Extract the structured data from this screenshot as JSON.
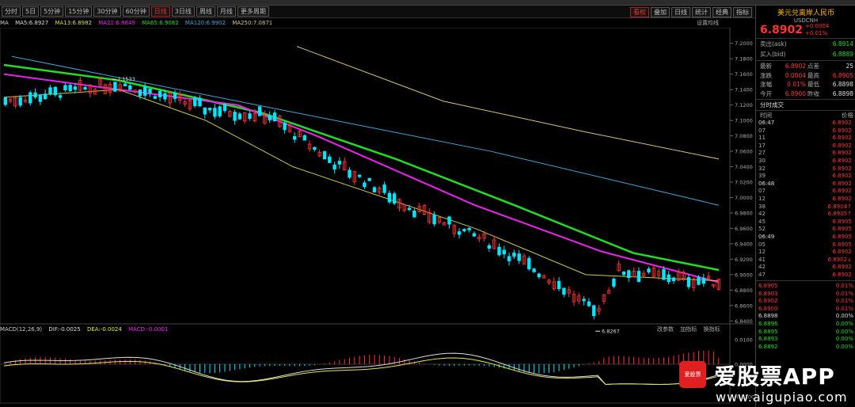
{
  "toolbar": {
    "periods": [
      "分时",
      "5日",
      "5分钟",
      "15分钟",
      "30分钟",
      "60分钟",
      "日线",
      "3日线",
      "周线",
      "月线",
      "更多周期"
    ],
    "active": "日线",
    "right_buttons": [
      "看权",
      "叠加",
      "日线",
      "统计",
      "经典",
      "指标"
    ]
  },
  "ma_legend": {
    "label": "MA",
    "ma5": "MA5:6.8927",
    "ma13": "MA13:6.8982",
    "ma21": "MA21:6.8849",
    "ma65": "MA65:6.9082",
    "ma120": "MA120:6.9902",
    "ma250": "MA250:7.0871",
    "right_note": "设置均线"
  },
  "right_panel": {
    "title": "美元兑离岸人民币",
    "code": "USDCNH",
    "price": "6.8902",
    "change": "+0.0004",
    "change_pct": "+0.01%",
    "ask_label": "卖出(ask)",
    "ask": "6.8914",
    "bid_label": "买入(bid)",
    "bid": "6.8889",
    "stats": [
      {
        "l1": "最新",
        "v1": "6.8902",
        "l2": "点差",
        "v2": "25"
      },
      {
        "l1": "涨跌",
        "v1": "0.0004",
        "l2": "最高",
        "v2": "6.8905"
      },
      {
        "l1": "涨幅",
        "v1": "0.01%",
        "l2": "最低",
        "v2": "6.8898"
      },
      {
        "l1": "今开",
        "v1": "6.8900",
        "l2": "昨收",
        "v2": "6.8898"
      }
    ],
    "ticks_title": "分时成交",
    "ticks_header_time": "时间",
    "ticks_header_price": "价格",
    "ticks": [
      {
        "t": "06:47",
        "p": "6.8902",
        "full": true
      },
      {
        "t": "07",
        "p": "6.8902"
      },
      {
        "t": "11",
        "p": "6.8902"
      },
      {
        "t": "17",
        "p": "6.8902"
      },
      {
        "t": "27",
        "p": "6.8902"
      },
      {
        "t": "30",
        "p": "6.8902"
      },
      {
        "t": "32",
        "p": "6.8902"
      },
      {
        "t": "39",
        "p": "6.8902"
      },
      {
        "t": "06:48",
        "p": "6.8902",
        "full": true
      },
      {
        "t": "07",
        "p": "6.8902"
      },
      {
        "t": "12",
        "p": "6.8902"
      },
      {
        "t": "38",
        "p": "6.8904↑"
      },
      {
        "t": "42",
        "p": "6.8905↑"
      },
      {
        "t": "45",
        "p": "6.8905"
      },
      {
        "t": "52",
        "p": "6.8905"
      },
      {
        "t": "06:49",
        "p": "6.8905",
        "full": true
      },
      {
        "t": "05",
        "p": "6.8905"
      },
      {
        "t": "12",
        "p": "6.8902"
      },
      {
        "t": "41",
        "p": "6.8902↓"
      },
      {
        "t": "42",
        "p": "6.8902"
      },
      {
        "t": "47",
        "p": "6.8902"
      }
    ],
    "depth": [
      {
        "p": "6.8905",
        "pct": "0.01%",
        "c": "red"
      },
      {
        "p": "6.8903",
        "pct": "0.01%",
        "c": "red"
      },
      {
        "p": "6.8902",
        "pct": "0.01%",
        "c": "red"
      },
      {
        "p": "6.8900",
        "pct": "0.01%",
        "c": "red"
      },
      {
        "p": "6.8898",
        "pct": "0.00%",
        "c": "white"
      },
      {
        "p": "6.8896",
        "pct": "0.00%",
        "c": "green"
      },
      {
        "p": "6.8895",
        "pct": "0.00%",
        "c": "green"
      },
      {
        "p": "6.8893",
        "pct": "0.00%",
        "c": "green"
      },
      {
        "p": "6.8892",
        "pct": "0.00%",
        "c": "green"
      }
    ]
  },
  "macd": {
    "label": "MACD(12,26,9)",
    "dif": "DIF:-0.0025",
    "dea": "DEA:-0.0024",
    "macd": "MACD:-0.0001",
    "tools": [
      "改参数",
      "加指标",
      "换指标"
    ],
    "axis": [
      "0.0100",
      "0.0000",
      "-0.0100"
    ]
  },
  "watermark": {
    "logo_text": "爱股票",
    "app": "爱股票APP",
    "url": "www.aigupiao.com"
  },
  "chart_data": {
    "type": "candlestick",
    "y_ticks": [
      "7.2000",
      "7.1800",
      "7.1600",
      "7.1400",
      "7.1200",
      "7.1000",
      "7.0800",
      "7.0600",
      "7.0400",
      "7.0200",
      "7.0000",
      "6.9800",
      "6.9600",
      "6.9400",
      "6.9200",
      "6.9000",
      "6.8800",
      "6.8600",
      "6.8400"
    ],
    "ylim": [
      6.83,
      7.21
    ],
    "annotations": [
      {
        "text": "7.1533",
        "value": 7.1533
      },
      {
        "text": "6.8267",
        "value": 6.8267
      }
    ],
    "series": [
      {
        "name": "MA250",
        "color": "#d8c27a",
        "values": [
          7.196,
          7.125,
          7.085,
          7.05
        ]
      },
      {
        "name": "MA120",
        "color": "#3aa7d8",
        "values": [
          7.183,
          7.125,
          7.06,
          6.99
        ]
      },
      {
        "name": "MA65",
        "color": "#22dd22",
        "values": [
          7.172,
          7.152,
          7.11,
          7.05,
          6.99,
          6.928,
          6.906
        ]
      },
      {
        "name": "MA21",
        "color": "#ee22ee",
        "values": [
          7.16,
          7.14,
          7.12,
          7.08,
          6.99,
          6.93,
          6.89
        ]
      },
      {
        "name": "MA5",
        "color": "#cccc44",
        "values": [
          7.13,
          7.14,
          7.1,
          7.04,
          6.96,
          6.9,
          6.892
        ]
      }
    ]
  }
}
